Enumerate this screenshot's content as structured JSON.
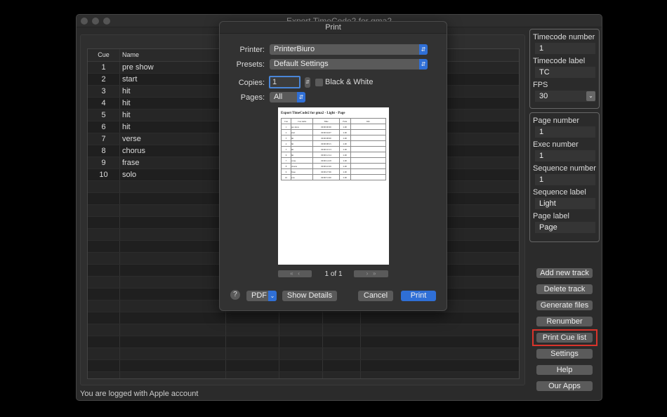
{
  "window": {
    "title": "Export TimeCode2 for gma2",
    "status": "You are logged with Apple account"
  },
  "table": {
    "headers": [
      "Cue",
      "Name"
    ],
    "rows": [
      {
        "cue": "1",
        "name": "pre show"
      },
      {
        "cue": "2",
        "name": "start"
      },
      {
        "cue": "3",
        "name": "hit"
      },
      {
        "cue": "4",
        "name": "hit"
      },
      {
        "cue": "5",
        "name": "hit"
      },
      {
        "cue": "6",
        "name": "hit"
      },
      {
        "cue": "7",
        "name": "verse"
      },
      {
        "cue": "8",
        "name": "chorus"
      },
      {
        "cue": "9",
        "name": "frase"
      },
      {
        "cue": "10",
        "name": "solo"
      }
    ]
  },
  "settings": {
    "timecode_number_label": "Timecode number",
    "timecode_number": "1",
    "timecode_label_label": "Timecode label",
    "timecode_label": "TC",
    "fps_label": "FPS",
    "fps": "30",
    "page_number_label": "Page number",
    "page_number": "1",
    "exec_number_label": "Exec number",
    "exec_number": "1",
    "sequence_number_label": "Sequence number",
    "sequence_number": "1",
    "sequence_label_label": "Sequence label",
    "sequence_label": "Light",
    "page_label_label": "Page label",
    "page_label": "Page"
  },
  "buttons": [
    "Add new track",
    "Delete track",
    "Generate files",
    "Renumber",
    "Print Cue list",
    "Settings",
    "Help",
    "Our Apps"
  ],
  "highlight_color": "#d9342b",
  "print": {
    "title": "Print",
    "printer_label": "Printer:",
    "printer": "PrinterBiuro",
    "presets_label": "Presets:",
    "presets": "Default Settings",
    "copies_label": "Copies:",
    "copies": "1",
    "bw_label": "Black & White",
    "pages_label": "Pages:",
    "pages": "All",
    "page_indicator": "1 of 1",
    "help": "?",
    "pdf": "PDF",
    "show_details": "Show Details",
    "cancel": "Cancel",
    "print": "Print",
    "accent": "#2f6fd6",
    "preview": {
      "title": "Export TimeCode2 for gma2 - Light - Page",
      "headers": [
        "Cue",
        "Cue name",
        "Time",
        "Fade",
        "Info"
      ],
      "rows": [
        [
          "1",
          "pre show",
          "00:00:00:00",
          "2.00",
          ""
        ],
        [
          "2",
          "start",
          "00:00:04:07",
          "2.00",
          ""
        ],
        [
          "3",
          "hit",
          "00:00:08:00",
          "2.00",
          ""
        ],
        [
          "4",
          "hit",
          "00:00:08:15",
          "2.00",
          ""
        ],
        [
          "5",
          "hit",
          "00:00:10:13",
          "2.00",
          ""
        ],
        [
          "6",
          "hit",
          "00:00:12:14",
          "2.00",
          ""
        ],
        [
          "7",
          "verse",
          "00:00:14:18",
          "2.00",
          ""
        ],
        [
          "8",
          "chorus",
          "00:00:22:29",
          "2.00",
          ""
        ],
        [
          "9",
          "frase",
          "00:00:27:06",
          "2.00",
          ""
        ],
        [
          "10",
          "solo",
          "00:00:31:00",
          "2.00",
          ""
        ]
      ]
    }
  }
}
